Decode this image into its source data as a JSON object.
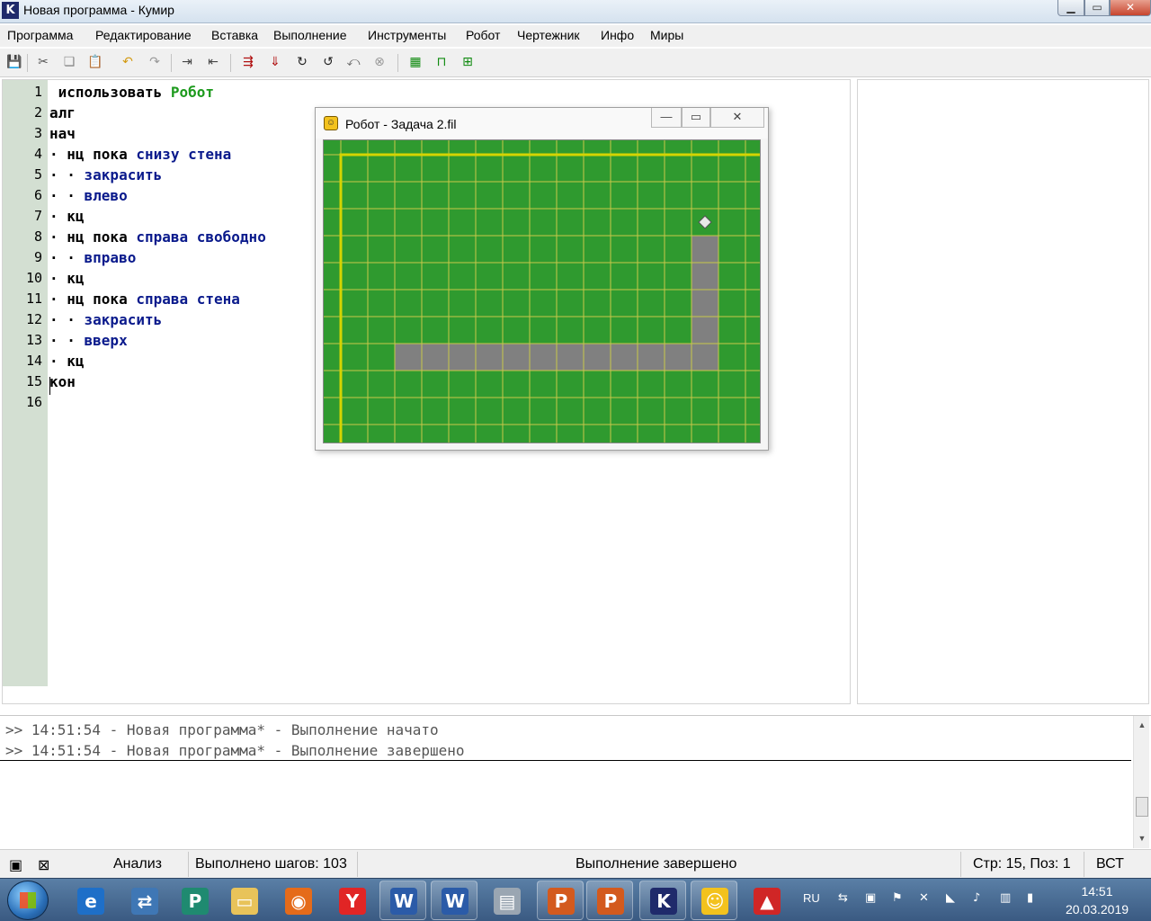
{
  "window": {
    "icon_letter": "K",
    "title": "Новая программа - Кумир",
    "buttons": {
      "minimize": "▁",
      "maximize": "▭",
      "close": "✕"
    }
  },
  "menu": [
    "Программа",
    "Редактирование",
    "Вставка",
    "Выполнение",
    "Инструменты",
    "Робот",
    "Чертежник",
    "Инфо",
    "Миры"
  ],
  "toolbar": {
    "icons": [
      {
        "name": "save-icon",
        "glyph": "💾",
        "color": "#333333"
      },
      {
        "name": "cut-icon",
        "glyph": "✂",
        "color": "#555555"
      },
      {
        "name": "copy-icon",
        "glyph": "❏",
        "color": "#888888"
      },
      {
        "name": "paste-icon",
        "glyph": "📋",
        "color": "#b07a1a"
      },
      {
        "name": "undo-icon",
        "glyph": "↶",
        "color": "#d39a12"
      },
      {
        "name": "redo-icon",
        "glyph": "↷",
        "color": "#999999"
      },
      {
        "name": "indent-icon",
        "glyph": "⇥",
        "color": "#444444"
      },
      {
        "name": "outdent-icon",
        "glyph": "⇤",
        "color": "#444444"
      },
      {
        "name": "run-icon",
        "glyph": "⇶",
        "color": "#b01010"
      },
      {
        "name": "step-over-icon",
        "glyph": "⇓",
        "color": "#b01010"
      },
      {
        "name": "step-in-icon",
        "glyph": "↻",
        "color": "#222222"
      },
      {
        "name": "step-out-icon",
        "glyph": "↺",
        "color": "#222222"
      },
      {
        "name": "step-back-icon",
        "glyph": "⤺",
        "color": "#666666"
      },
      {
        "name": "stop-icon",
        "glyph": "⊗",
        "color": "#9a9a9a"
      },
      {
        "name": "robot-world-icon",
        "glyph": "▦",
        "color": "#0f8a0f"
      },
      {
        "name": "robot-window-icon",
        "glyph": "⊓",
        "color": "#0f8a0f"
      },
      {
        "name": "draw-world-icon",
        "glyph": "⊞",
        "color": "#0f8a0f"
      }
    ]
  },
  "editor": {
    "line_numbers": [
      "1",
      "2",
      "3",
      "4",
      "5",
      "6",
      "7",
      "8",
      "9",
      "10",
      "11",
      "12",
      "13",
      "14",
      "15",
      "16"
    ],
    "lines": [
      [
        {
          "t": " использовать ",
          "c": ""
        },
        {
          "t": "Робот",
          "c": "kw-green"
        }
      ],
      [
        {
          "t": "алг",
          "c": ""
        }
      ],
      [
        {
          "t": "нач",
          "c": ""
        }
      ],
      [
        {
          "t": "· нц пока ",
          "c": ""
        },
        {
          "t": "снизу стена",
          "c": "kw-blue"
        }
      ],
      [
        {
          "t": "· · ",
          "c": ""
        },
        {
          "t": "закрасить",
          "c": "kw-blue"
        }
      ],
      [
        {
          "t": "· · ",
          "c": ""
        },
        {
          "t": "влево",
          "c": "kw-blue"
        }
      ],
      [
        {
          "t": "· кц",
          "c": ""
        }
      ],
      [
        {
          "t": "· нц пока ",
          "c": ""
        },
        {
          "t": "справа свободно",
          "c": "kw-blue"
        }
      ],
      [
        {
          "t": "· · ",
          "c": ""
        },
        {
          "t": "вправо",
          "c": "kw-blue"
        }
      ],
      [
        {
          "t": "· кц",
          "c": ""
        }
      ],
      [
        {
          "t": "· нц пока ",
          "c": ""
        },
        {
          "t": "справа стена",
          "c": "kw-blue"
        }
      ],
      [
        {
          "t": "· · ",
          "c": ""
        },
        {
          "t": "закрасить",
          "c": "kw-blue"
        }
      ],
      [
        {
          "t": "· · ",
          "c": ""
        },
        {
          "t": "вверх",
          "c": "kw-blue"
        }
      ],
      [
        {
          "t": "· кц",
          "c": ""
        }
      ],
      [
        {
          "t": "кон",
          "c": ""
        }
      ],
      [
        {
          "t": "",
          "c": ""
        }
      ]
    ]
  },
  "robot_window": {
    "title": "Робот - Задача 2.fil",
    "buttons": {
      "minimize": "—",
      "maximize": "▭",
      "close": "✕"
    },
    "field": {
      "cols": 16,
      "rows": 11,
      "colors": {
        "background": "#2f9a2f",
        "grid": "#c8c84a",
        "wall": "#d4d400",
        "painted": "#808080",
        "robot": "#e8e8e8"
      },
      "painted_cells": [
        [
          13,
          3
        ],
        [
          13,
          4
        ],
        [
          13,
          5
        ],
        [
          13,
          6
        ],
        [
          2,
          7
        ],
        [
          3,
          7
        ],
        [
          4,
          7
        ],
        [
          5,
          7
        ],
        [
          6,
          7
        ],
        [
          7,
          7
        ],
        [
          8,
          7
        ],
        [
          9,
          7
        ],
        [
          10,
          7
        ],
        [
          11,
          7
        ],
        [
          12,
          7
        ],
        [
          13,
          7
        ]
      ],
      "robot_at": [
        13,
        2
      ]
    }
  },
  "output": {
    "lines": [
      ">> 14:51:54 - Новая программа* - Выполнение начато",
      ">> 14:51:54 - Новая программа* - Выполнение завершено"
    ]
  },
  "statusbar": {
    "mode": "Анализ",
    "steps": "Выполнено шагов: 103",
    "status": "Выполнение завершено",
    "position": "Стр: 15, Поз: 1",
    "insert_mode": "ВСТ"
  },
  "taskbar": {
    "apps": [
      {
        "name": "internet-explorer-icon",
        "glyph": "e",
        "bg": "#1e6fc8",
        "plain": true
      },
      {
        "name": "network-icon",
        "glyph": "⇄",
        "bg": "#3f77b5",
        "plain": true
      },
      {
        "name": "publisher-icon",
        "glyph": "P",
        "bg": "#1f8a70",
        "plain": true
      },
      {
        "name": "folder-icon",
        "glyph": "▭",
        "bg": "#e8c35a",
        "plain": true
      },
      {
        "name": "firefox-icon",
        "glyph": "◉",
        "bg": "#e56b1a",
        "plain": true
      },
      {
        "name": "yandex-icon",
        "glyph": "Y",
        "bg": "#e12525",
        "plain": true
      },
      {
        "name": "word-icon",
        "glyph": "W",
        "bg": "#2b5ba8",
        "plain": false
      },
      {
        "name": "word-icon-2",
        "glyph": "W",
        "bg": "#2b5ba8",
        "plain": false
      },
      {
        "name": "printer-icon",
        "glyph": "▤",
        "bg": "#9aa6b2",
        "plain": true
      },
      {
        "name": "powerpoint-icon",
        "glyph": "P",
        "bg": "#d35a1e",
        "plain": false
      },
      {
        "name": "powerpoint-icon-2",
        "glyph": "P",
        "bg": "#d35a1e",
        "plain": false
      },
      {
        "name": "kumir-icon",
        "glyph": "K",
        "bg": "#1f2a6b",
        "plain": false
      },
      {
        "name": "robot-icon",
        "glyph": "☺",
        "bg": "#f3c21d",
        "plain": false
      },
      {
        "name": "pdf-icon",
        "glyph": "▲",
        "bg": "#d02626",
        "plain": true
      }
    ],
    "language": "RU",
    "time": "14:51",
    "date": "20.03.2019"
  }
}
